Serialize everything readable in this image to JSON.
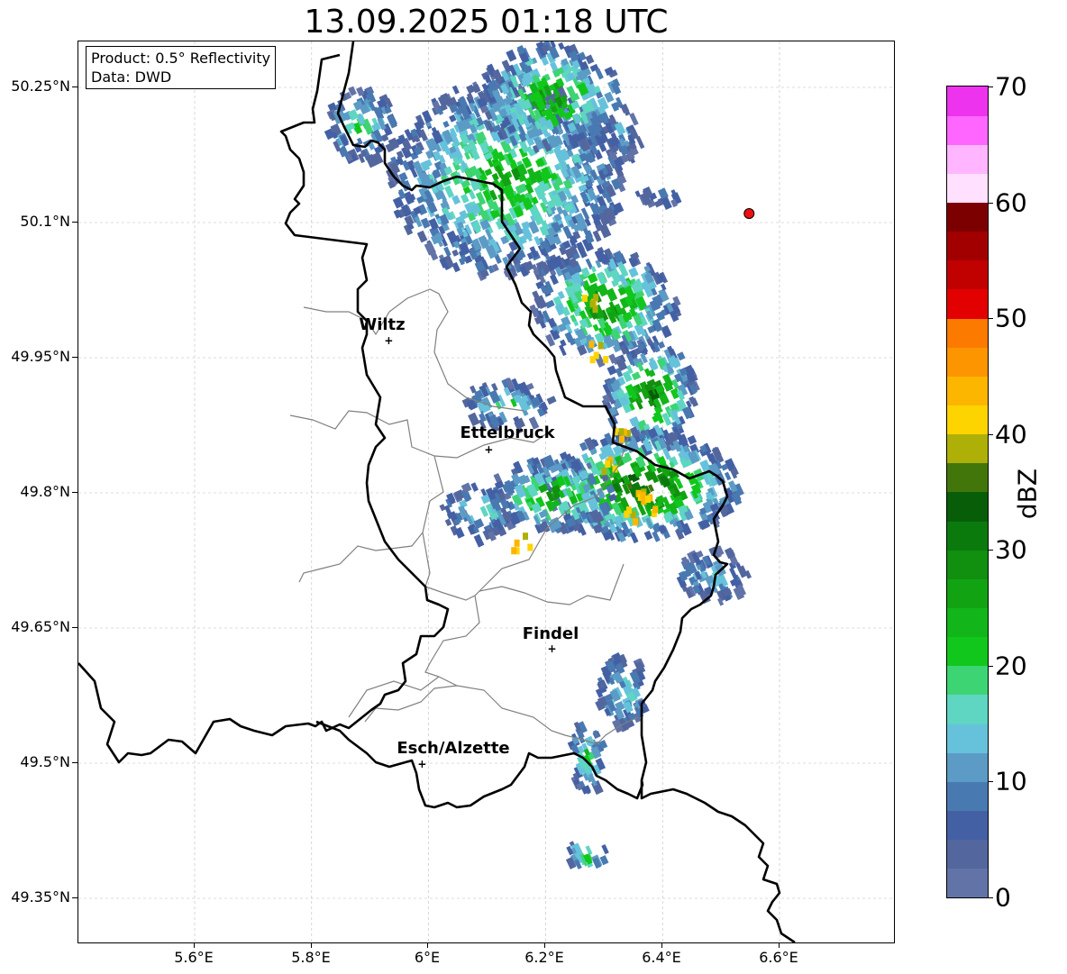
{
  "title": "13.09.2025 01:18 UTC",
  "info_box": {
    "product": "Product: 0.5° Reflectivity",
    "data": "Data: DWD"
  },
  "axes": {
    "lat_ticks": [
      "50.25°N",
      "50.1°N",
      "49.95°N",
      "49.8°N",
      "49.65°N",
      "49.5°N",
      "49.35°N"
    ],
    "lon_ticks": [
      "5.6°E",
      "5.8°E",
      "6°E",
      "6.2°E",
      "6.4°E",
      "6.6°E"
    ]
  },
  "cities": [
    {
      "name": "Wiltz",
      "lat": 49.969,
      "lon": 5.932
    },
    {
      "name": "Ettelbruck",
      "lat": 49.848,
      "lon": 6.103
    },
    {
      "name": "Findel",
      "lat": 49.627,
      "lon": 6.211
    },
    {
      "name": "Esch/Alzette",
      "lat": 49.499,
      "lon": 5.989
    }
  ],
  "radar_site": {
    "lat": 50.11,
    "lon": 6.548,
    "color": "#ee1111"
  },
  "colorbar": {
    "label": "dBZ",
    "ticks": [
      "0",
      "10",
      "20",
      "30",
      "40",
      "50",
      "60",
      "70"
    ],
    "colors": [
      "#6273a8",
      "#53679e",
      "#4460a4",
      "#4979b1",
      "#5b9bc5",
      "#66c2db",
      "#5ed6c2",
      "#3dd473",
      "#11c71c",
      "#12b61a",
      "#12a312",
      "#10900e",
      "#0b7a0d",
      "#085e08",
      "#43760a",
      "#aeb008",
      "#fdd400",
      "#fdb600",
      "#fd9500",
      "#fd7a00",
      "#e30000",
      "#c10000",
      "#a20000",
      "#7d0000",
      "#ffe0ff",
      "#ffb5ff",
      "#ff66ff",
      "#ee33ee"
    ]
  },
  "colors": {
    "border": "#000000",
    "canton": "#808080",
    "grid": "#bbbbbb"
  }
}
